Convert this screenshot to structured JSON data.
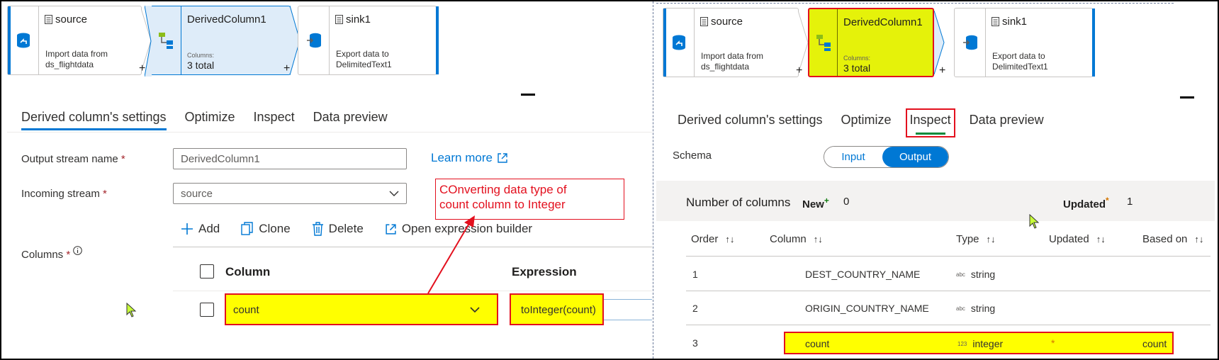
{
  "left": {
    "pipeline": {
      "source": {
        "title": "source",
        "desc_line1": "Import data from",
        "desc_line2": "ds_flightdata"
      },
      "derived": {
        "title": "DerivedColumn1",
        "columns_label": "Columns:",
        "columns_value": "3 total"
      },
      "sink": {
        "title": "sink1",
        "desc_line1": "Export data to",
        "desc_line2": "DelimitedText1"
      },
      "plus": "+"
    },
    "tabs": [
      "Derived column's settings",
      "Optimize",
      "Inspect",
      "Data preview"
    ],
    "form": {
      "output_stream_label": "Output stream name",
      "output_stream_value": "DerivedColumn1",
      "incoming_stream_label": "Incoming stream",
      "incoming_stream_value": "source",
      "columns_label": "Columns",
      "required_mark": "*",
      "learn_more": "Learn more"
    },
    "toolbar": {
      "add": "Add",
      "clone": "Clone",
      "delete": "Delete",
      "expression_builder": "Open expression builder"
    },
    "grid": {
      "column_header": "Column",
      "expression_header": "Expression",
      "row": {
        "column": "count",
        "expression": "toInteger(count)"
      }
    },
    "annotation": {
      "line1": "COnverting data type of",
      "line2": "count column to Integer"
    }
  },
  "right": {
    "pipeline": {
      "source": {
        "title": "source",
        "desc_line1": "Import data from",
        "desc_line2": "ds_flightdata"
      },
      "derived": {
        "title": "DerivedColumn1",
        "columns_label": "Columns:",
        "columns_value": "3 total"
      },
      "sink": {
        "title": "sink1",
        "desc_line1": "Export data to",
        "desc_line2": "DelimitedText1"
      },
      "plus": "+"
    },
    "tabs": [
      "Derived column's settings",
      "Optimize",
      "Inspect",
      "Data preview"
    ],
    "schema_label": "Schema",
    "toggle": {
      "input": "Input",
      "output": "Output"
    },
    "summary": {
      "num_columns": "Number of columns",
      "new_label": "New",
      "new_value": "0",
      "updated_label": "Updated",
      "updated_value": "1",
      "new_mark": "+",
      "updated_mark": "*"
    },
    "table": {
      "headers": [
        "Order",
        "Column",
        "Type",
        "Updated",
        "Based on"
      ],
      "rows": [
        {
          "order": "1",
          "column": "DEST_COUNTRY_NAME",
          "type_badge": "abc",
          "type": "string",
          "updated": "",
          "based_on": ""
        },
        {
          "order": "2",
          "column": "ORIGIN_COUNTRY_NAME",
          "type_badge": "abc",
          "type": "string",
          "updated": "",
          "based_on": ""
        },
        {
          "order": "3",
          "column": "count",
          "type_badge": "123",
          "type": "integer",
          "updated": "*",
          "based_on": "count"
        }
      ]
    }
  },
  "colors": {
    "accent": "#0078d4",
    "highlight": "#ffff00",
    "annotation": "#e3101e",
    "node_highlight": "#e5f20a"
  }
}
